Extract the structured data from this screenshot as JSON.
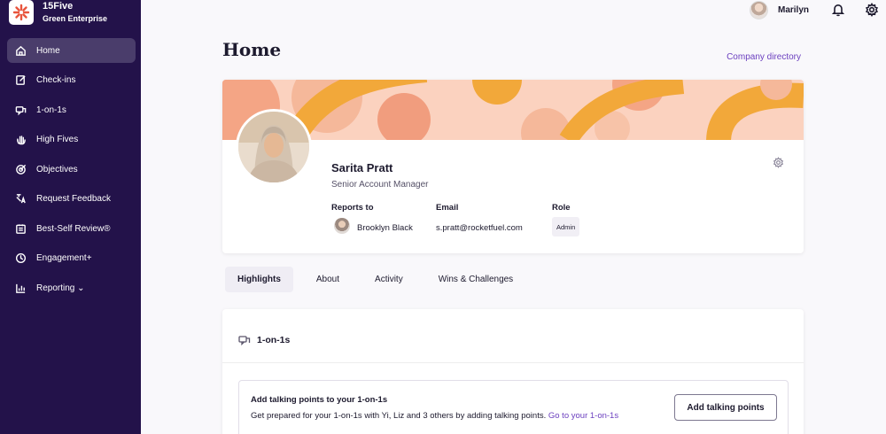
{
  "org": {
    "name": "15Five",
    "subtitle": "Green Enterprise"
  },
  "sidebar": {
    "items": [
      {
        "label": "Home",
        "icon": "home-icon",
        "active": true
      },
      {
        "label": "Check-ins",
        "icon": "edit-icon"
      },
      {
        "label": "1-on-1s",
        "icon": "chat-icon"
      },
      {
        "label": "High Fives",
        "icon": "hand-icon"
      },
      {
        "label": "Objectives",
        "icon": "target-icon"
      },
      {
        "label": "Request Feedback",
        "icon": "feedback-icon"
      },
      {
        "label": "Best-Self Review®",
        "icon": "review-icon"
      },
      {
        "label": "Engagement+",
        "icon": "engagement-icon"
      },
      {
        "label": "Reporting ⌄",
        "icon": "chart-icon"
      }
    ]
  },
  "topbar": {
    "user_name": "Marilyn"
  },
  "main": {
    "title": "Home",
    "company_directory": "Company directory",
    "profile": {
      "name": "Sarita Pratt",
      "job_title": "Senior Account Manager",
      "reports_to_label": "Reports to",
      "reports_to_value": "Brooklyn Black",
      "email_label": "Email",
      "email_value": "s.pratt@rocketfuel.com",
      "role_label": "Role",
      "role_value": "Admin"
    },
    "tabs": [
      {
        "label": "Highlights",
        "active": true
      },
      {
        "label": "About"
      },
      {
        "label": "Activity"
      },
      {
        "label": "Wins & Challenges"
      }
    ],
    "section": {
      "title": "1-on-1s",
      "talking_points_heading": "Add talking points to your 1-on-1s",
      "talking_points_text": "Get prepared for your 1-on-1s with Yi, Liz and 3 others by adding talking points.",
      "talking_points_link": "Go to your 1-on-1s",
      "add_button": "Add talking points"
    }
  },
  "colors": {
    "sidebar_bg": "#23124a",
    "accent": "#6b3fbf",
    "banner_orange": "#f2a83a",
    "banner_peach": "#fbd2bf"
  }
}
